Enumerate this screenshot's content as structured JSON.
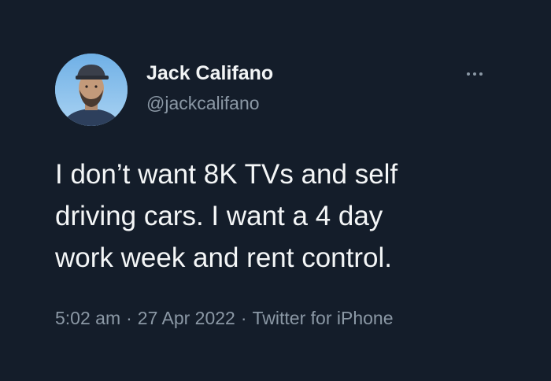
{
  "author": {
    "display_name": "Jack Califano",
    "handle": "@jackcalifano",
    "avatar_icon": "profile-photo"
  },
  "tweet": {
    "lines": [
      "I don’t want 8K TVs and self",
      "driving cars. I want a 4 day",
      "work week and rent control."
    ],
    "time": "5:02 am",
    "separator": "·",
    "date": "27 Apr 2022",
    "source": "Twitter for iPhone"
  },
  "menu": {
    "icon": "more-options-icon"
  },
  "colors": {
    "background": "#141d2a",
    "primary_text": "#f4f6f7",
    "secondary_text": "#8b98a5"
  }
}
